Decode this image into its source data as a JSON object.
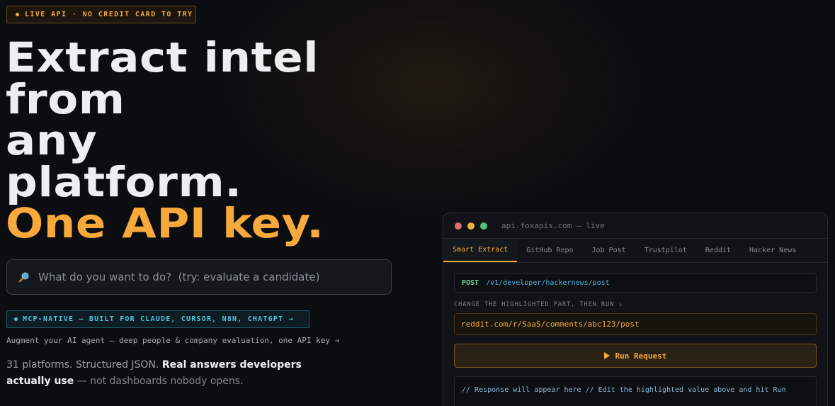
{
  "badge": {
    "text": "LIVE API · NO CREDIT CARD TO TRY",
    "color": "#f0a640"
  },
  "hero": {
    "lines": [
      "Extract intel",
      "from",
      "any",
      "platform.",
      "One API key."
    ],
    "accent_color": "#f7a93b"
  },
  "search": {
    "icon": "magnifier-icon",
    "placeholder": "What do you want to do?  (try: evaluate a candidate)",
    "value": ""
  },
  "mcp": {
    "text": "MCP-NATIVE — BUILT FOR CLAUDE, CURSOR, N8N, CHATGPT →",
    "color": "#4ec4df"
  },
  "augment": "Augment your AI agent — deep people & company evaluation, one API key →",
  "tagline": {
    "part1": "31 platforms. Structured JSON. ",
    "strong1": "Real answers developers",
    "strong2": "actually use",
    "part2": " — not dashboards nobody opens."
  },
  "terminal": {
    "title": "api.foxapis.com — live",
    "lights": [
      "#e06c6c",
      "#f0b43c",
      "#52c47a"
    ],
    "tabs": [
      "Smart Extract",
      "GitHub Repo",
      "Job Post",
      "Trustpilot",
      "Reddit",
      "Hacker News"
    ],
    "active_tab": "Smart Extract",
    "method": "POST",
    "path": "/v1/developer/hackernews/post",
    "hint": "CHANGE THE HIGHLIGHTED PART, THEN RUN ↓",
    "input_value": "reddit.com/r/SaaS/comments/abc123/post",
    "run_label": "Run Request",
    "response_placeholder": "// Response will appear here // Edit the highlighted value above and hit Run"
  }
}
